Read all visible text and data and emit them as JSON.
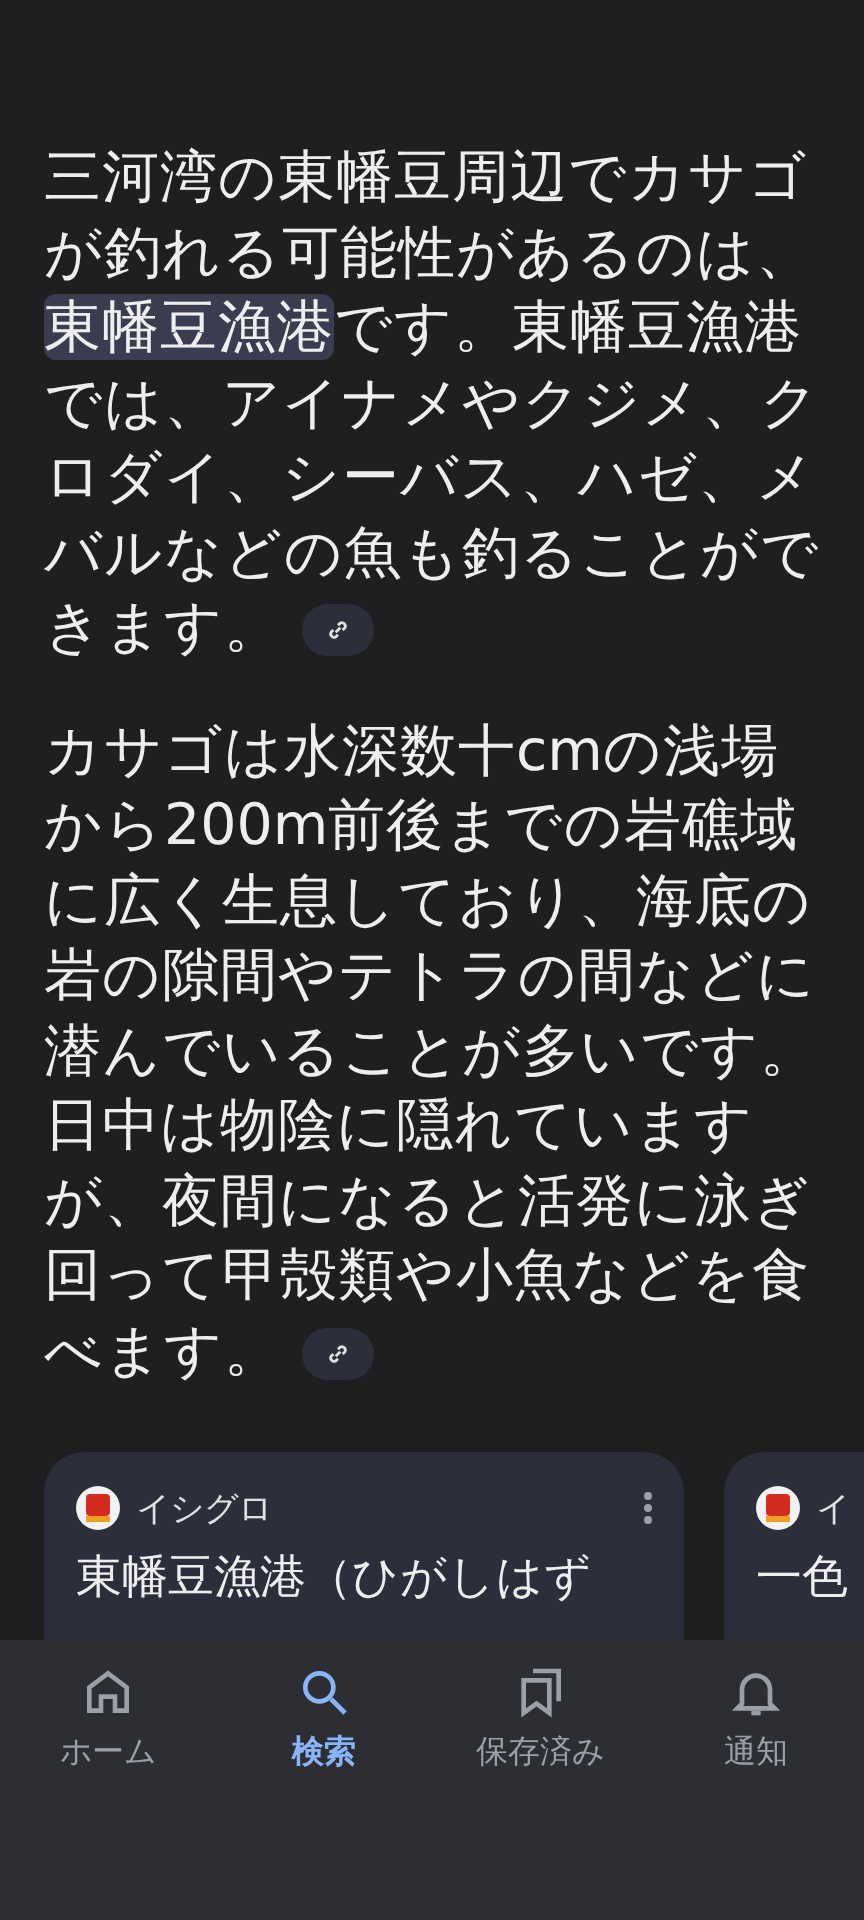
{
  "answer": {
    "paragraphs": [
      {
        "segments": [
          {
            "text": "三河湾の東幡豆周辺でカサゴが釣れる可能性があるのは、",
            "highlighted": false
          },
          {
            "text": "東幡豆漁港",
            "highlighted": true
          },
          {
            "text": "です。東幡豆漁港では、アイナメやクジメ、クロダイ、シーバス、ハゼ、メバルなどの魚も釣ることができます。",
            "highlighted": false
          }
        ]
      },
      {
        "segments": [
          {
            "text": "カサゴは水深数十cmの浅場から200m前後までの岩礁域に広く生息しており、海底の岩の隙間やテトラの間などに潜んでいることが多いです。日中は物陰に隠れていますが、夜間になると活発に泳ぎ回って甲殻類や小魚などを食べます。",
            "highlighted": false
          }
        ]
      }
    ]
  },
  "sources": [
    {
      "source": "イシグロ",
      "title": "東幡豆漁港（ひがしはず",
      "menu": true
    },
    {
      "source": "イ",
      "title": "一色",
      "menu": false
    }
  ],
  "nav": [
    {
      "label": "ホーム",
      "selected": false
    },
    {
      "label": "検索",
      "selected": true
    },
    {
      "label": "保存済み",
      "selected": false
    },
    {
      "label": "通知",
      "selected": false
    }
  ]
}
